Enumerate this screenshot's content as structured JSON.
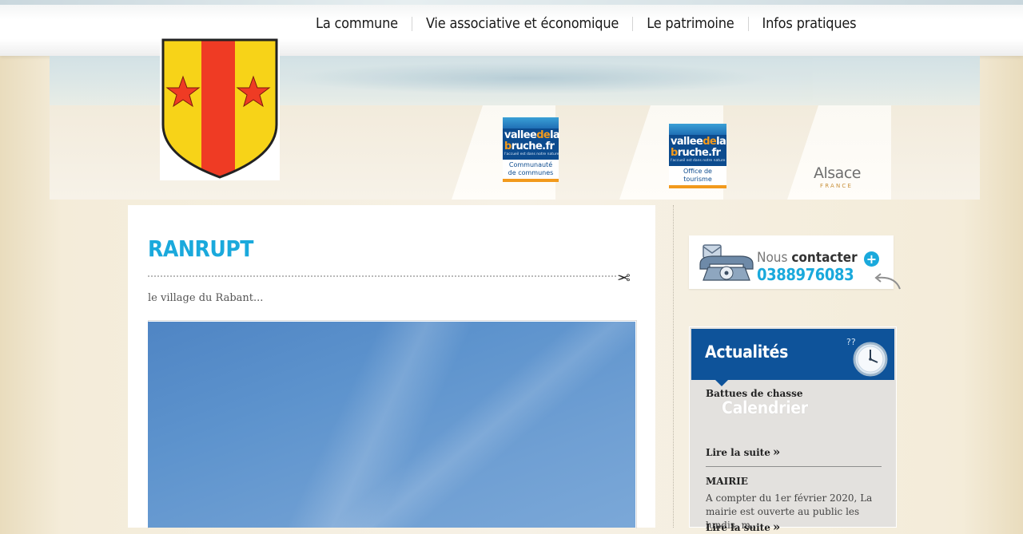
{
  "nav": {
    "items": [
      {
        "label": "La commune"
      },
      {
        "label": "Vie associative et économique"
      },
      {
        "label": "Le patrimoine"
      },
      {
        "label": "Infos pratiques"
      }
    ]
  },
  "banner": {
    "logo_ccvb": {
      "line1": "valleedela",
      "line2": "bruche.fr",
      "tagline": "l'accueil est dans notre nature",
      "caption_line1": "Communauté",
      "caption_line2": "de communes"
    },
    "logo_otvb": {
      "line1": "valleedela",
      "line2": "bruche.fr",
      "tagline": "l'accueil est dans notre nature",
      "caption": "Office de tourisme"
    },
    "alsace": {
      "name": "Alsace",
      "sub": "FRANCE"
    }
  },
  "main": {
    "title": "RANRUPT",
    "subtitle": "le village du Rabant..."
  },
  "contact": {
    "label_light": "Nous",
    "label_bold": "contacter",
    "phone": "0388976083",
    "plus": "+"
  },
  "news": {
    "heading": "Actualités",
    "items": [
      {
        "title": "Battues de chasse",
        "image_text": "Calendrier",
        "read_more": "Lire la suite",
        "arrow": "»"
      },
      {
        "title": "MAIRIE",
        "text": "A compter du 1er février 2020, La mairie est ouverte au public les lundis, m...",
        "read_more": "Lire la suite",
        "arrow": "»"
      }
    ]
  },
  "colors": {
    "accent": "#1aa9dc",
    "news_header": "#0e539a",
    "logo_orange": "#f29a1d"
  }
}
